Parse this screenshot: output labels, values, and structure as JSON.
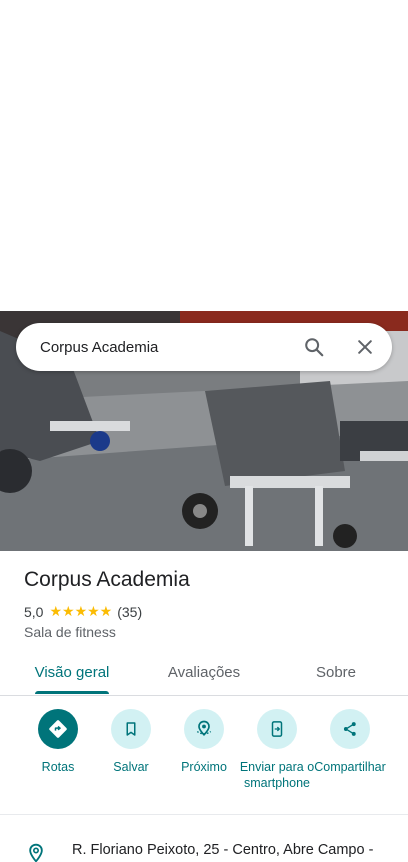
{
  "search": {
    "query": "Corpus Academia"
  },
  "place": {
    "name": "Corpus Academia",
    "rating": "5,0",
    "stars": "★★★★★",
    "review_count": "(35)",
    "category": "Sala de fitness"
  },
  "tabs": [
    {
      "label": "Visão geral",
      "active": true
    },
    {
      "label": "Avaliações",
      "active": false
    },
    {
      "label": "Sobre",
      "active": false
    }
  ],
  "actions": [
    {
      "label": "Rotas",
      "icon": "directions-icon"
    },
    {
      "label": "Salvar",
      "icon": "bookmark-icon"
    },
    {
      "label": "Próximo",
      "icon": "nearby-icon"
    },
    {
      "label": "Enviar para o smartphone",
      "icon": "send-to-phone-icon"
    },
    {
      "label": "Compartilhar",
      "icon": "share-icon"
    }
  ],
  "address": {
    "text": "R. Floriano Peixoto, 25 - Centro, Abre Campo -",
    "icon": "location-pin-icon"
  },
  "colors": {
    "accent": "#00747a",
    "accent_light": "#d2f1f3",
    "star": "#fbbc04"
  }
}
